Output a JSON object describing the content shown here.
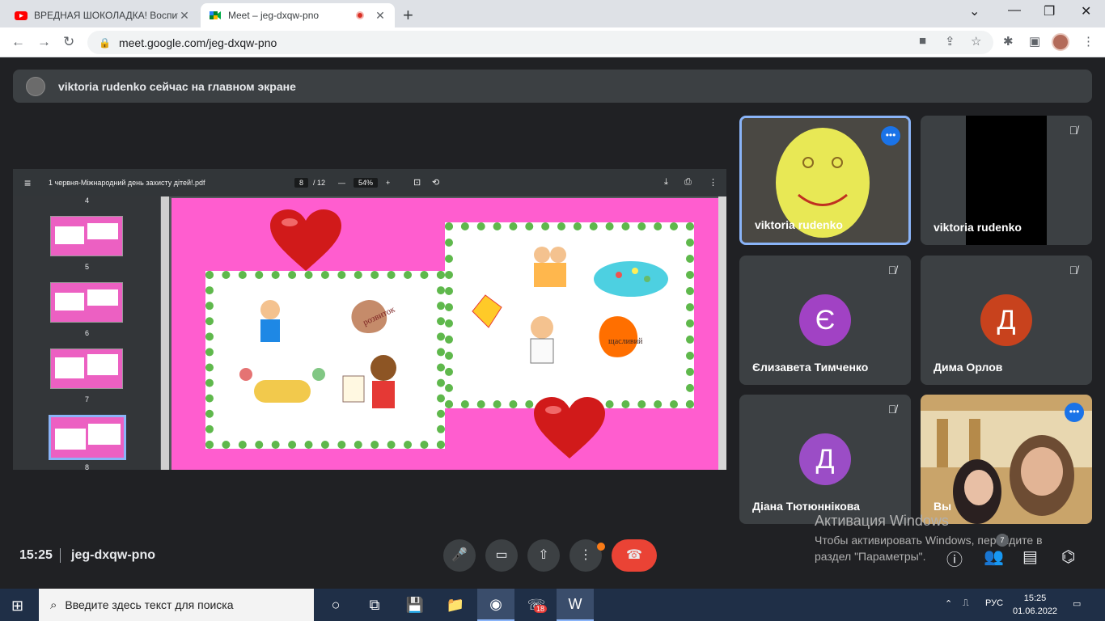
{
  "browser": {
    "tabs": [
      {
        "title": "ВРЕДНАЯ ШОКОЛАДКА! Воспит",
        "icon": "youtube-icon"
      },
      {
        "title": "Meet – jeg-dxqw-pno",
        "icon": "google-meet-icon",
        "active": true
      }
    ],
    "url": "meet.google.com/jeg-dxqw-pno"
  },
  "banner": {
    "text": "viktoria rudenko сейчас на главном экране"
  },
  "presentation": {
    "filename": "1 червня-Міжнародний день захисту дітей!.pdf",
    "page_current": "8",
    "page_total": "/ 12",
    "zoom": "54%",
    "thumbs": [
      {
        "num": "4"
      },
      {
        "num": "5"
      },
      {
        "num": "6"
      },
      {
        "num": "7"
      },
      {
        "num": "8"
      }
    ],
    "hand_label_left": "розвиток",
    "hand_label_right": "щасливий"
  },
  "participants": [
    {
      "name": "viktoria rudenko",
      "type": "video",
      "speaking": true
    },
    {
      "name": "viktoria rudenko",
      "type": "video-dark",
      "muted": true
    },
    {
      "name": "Єлизавета Тимченко",
      "initial": "Є",
      "color": "#a142c4",
      "muted": true
    },
    {
      "name": "Дима Орлов",
      "initial": "Д",
      "color": "#c8421d",
      "muted": true
    },
    {
      "name": "Діана Тютюннікова",
      "initial": "Д",
      "color": "#9b4dc6",
      "muted": true
    },
    {
      "name": "Вы",
      "type": "video-self"
    }
  ],
  "bottom": {
    "time": "15:25",
    "meeting_code": "jeg-dxqw-pno",
    "participant_count": "7"
  },
  "watermark": {
    "line1": "Активация Windows",
    "line2": "Чтобы активировать Windows, перейдите в",
    "line3": "раздел \"Параметры\"."
  },
  "taskbar": {
    "search_placeholder": "Введите здесь текст для поиска",
    "viber_badge": "18",
    "lang": "РУС",
    "time": "15:25",
    "date": "01.06.2022"
  }
}
